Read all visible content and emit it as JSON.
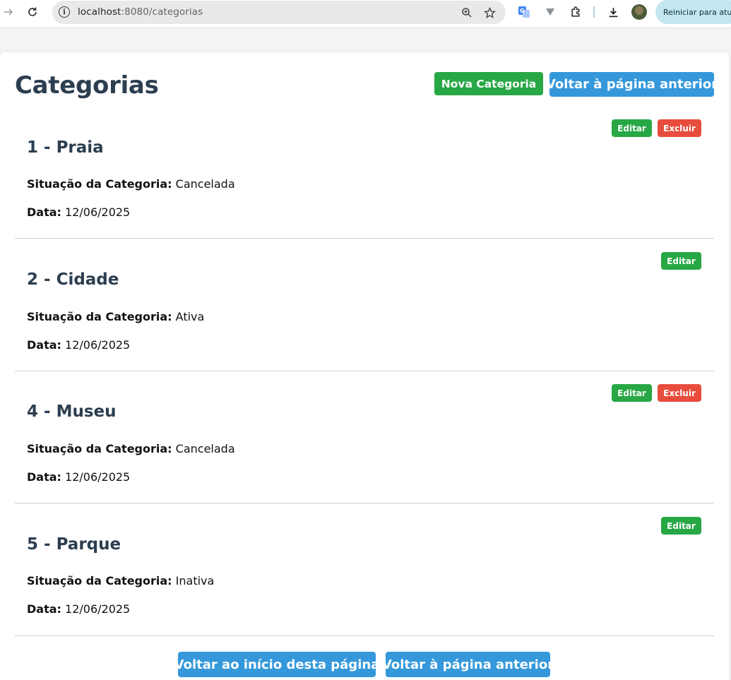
{
  "browser": {
    "url_host": "localhost",
    "url_rest": ":8080/categorias",
    "restart_label": "Reiniciar para atualizar"
  },
  "page": {
    "title": "Categorias",
    "new_button": "Nova Categoria",
    "back_button": "Voltar à página anterior",
    "footer_top_button": "Voltar ao início desta página",
    "footer_back_button": "Voltar à página anterior"
  },
  "labels": {
    "status": "Situação da Categoria:",
    "date": "Data:",
    "edit": "Editar",
    "delete": "Excluir"
  },
  "categories": [
    {
      "title": "1 - Praia",
      "status": "Cancelada",
      "date": "12/06/2025"
    },
    {
      "title": "2 - Cidade",
      "status": "Ativa",
      "date": "12/06/2025"
    },
    {
      "title": "4 - Museu",
      "status": "Cancelada",
      "date": "12/06/2025"
    },
    {
      "title": "5 - Parque",
      "status": "Inativa",
      "date": "12/06/2025"
    }
  ],
  "colors": {
    "green": "#28a745",
    "blue": "#3498db",
    "red": "#e74c3c",
    "heading": "#2c3e50"
  }
}
